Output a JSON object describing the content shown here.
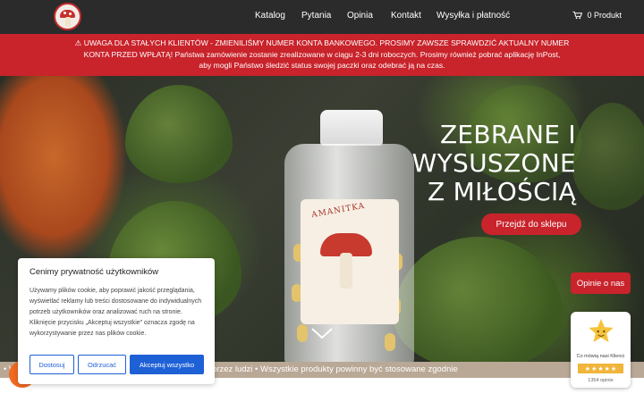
{
  "nav": {
    "links": [
      "Katalog",
      "Pytania",
      "Opinia",
      "Kontakt",
      "Wysyłka i płatność"
    ],
    "cart_label": "0 Produkt"
  },
  "alert": {
    "line1": "⚠ UWAGA DLA STAŁYCH KLIENTÓW - ZMIENILIŚMY NUMER KONTA BANKOWEGO. PROSIMY ZAWSZE SPRAWDZIĆ AKTUALNY NUMER",
    "line2": "KONTA PRZED WPŁATĄ! Państwa zamówienie zostanie zrealizowane w ciągu 2-3 dni roboczych. Prosimy również pobrać aplikację InPost,",
    "line3": "aby mogli Państwo śledzić status swojej paczki oraz odebrać ją na czas."
  },
  "hero": {
    "title_lines": [
      "ZEBRANE I",
      "WYSUSZONE",
      "Z MIŁOŚCIĄ"
    ],
    "jar_label": "AMANITKA",
    "cta": "Przejdź do sklepu"
  },
  "reviews": {
    "tab_label": "Opinie o nas",
    "widget_label": "Co mówią nasi Klienci",
    "count": "1354 opinie"
  },
  "ticker": {
    "text": "• Wszystkie produkty nie są przeznaczone do spożycia przez ludzi • Wszystkie produkty powinny być stosowane zgodnie"
  },
  "cookie": {
    "title": "Cenimy prywatność użytkowników",
    "body": "Używamy plików cookie, aby poprawić jakość przeglądania, wyświetlać reklamy lub treści dostosowane do indywidualnych potrzeb użytkowników oraz analizować ruch na stronie. Kliknięcie przycisku „Akceptuj wszystkie” oznacza zgodę na wykorzystywanie przez nas plików cookie.",
    "btn_customize": "Dostosuj",
    "btn_reject": "Odrzucać",
    "btn_accept": "Akceptuj wszystko"
  },
  "colors": {
    "nav_bg": "#2b2b2b",
    "accent_red": "#c9232b",
    "cookie_blue": "#1e60d6",
    "ticker_bg": "#b9a895",
    "star_gold": "#f1b53c"
  },
  "icons": [
    "logo-mushroom",
    "cart-icon",
    "chevron-down-icon",
    "star-icon",
    "chat-bubble-icon"
  ]
}
